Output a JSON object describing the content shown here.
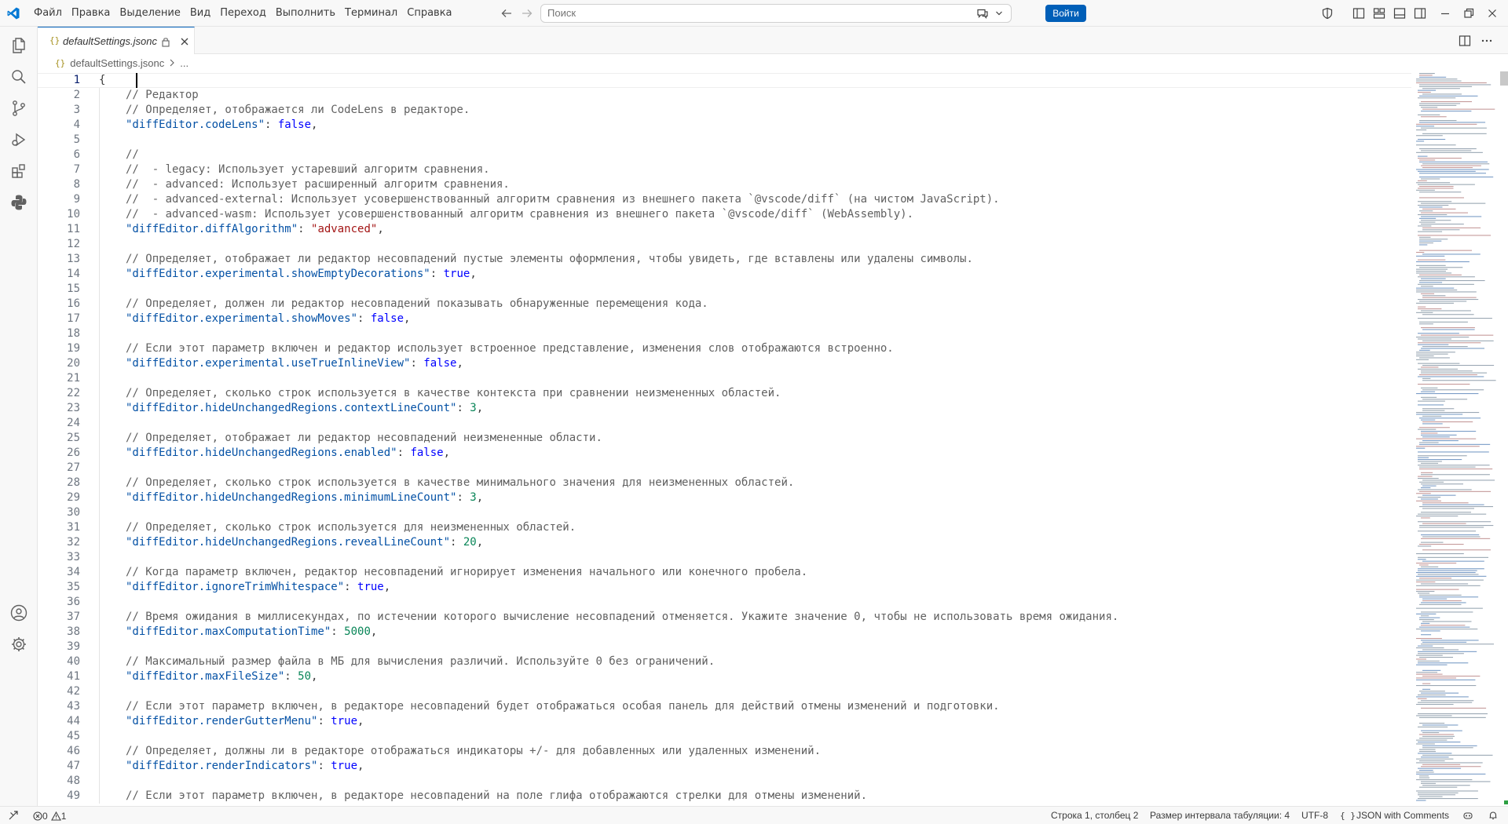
{
  "menu": [
    "Файл",
    "Правка",
    "Выделение",
    "Вид",
    "Переход",
    "Выполнить",
    "Терминал",
    "Справка"
  ],
  "search": {
    "placeholder": "Поиск"
  },
  "titlebar": {
    "signin_label": "Войти"
  },
  "tab": {
    "json_glyph": "{}",
    "title": "defaultSettings.jsonc"
  },
  "breadcrumb": {
    "file": "defaultSettings.jsonc",
    "rest": "..."
  },
  "editor": {
    "lines": [
      [
        [
          "p",
          "{"
        ]
      ],
      [
        [
          "c",
          "// Редактор"
        ]
      ],
      [
        [
          "c",
          "// Определяет, отображается ли CodeLens в редакторе."
        ]
      ],
      [
        [
          "k",
          "\"diffEditor.codeLens\""
        ],
        [
          "p",
          ": "
        ],
        [
          "b",
          "false"
        ],
        [
          "p",
          ","
        ]
      ],
      [],
      [
        [
          "c",
          "//"
        ]
      ],
      [
        [
          "c",
          "//  - legacy: Использует устаревший алгоритм сравнения."
        ]
      ],
      [
        [
          "c",
          "//  - advanced: Использует расширенный алгоритм сравнения."
        ]
      ],
      [
        [
          "c",
          "//  - advanced-external: Использует усовершенствованный алгоритм сравнения из внешнего пакета `@vscode/diff` (на чистом JavaScript)."
        ]
      ],
      [
        [
          "c",
          "//  - advanced-wasm: Использует усовершенствованный алгоритм сравнения из внешнего пакета `@vscode/diff` (WebAssembly)."
        ]
      ],
      [
        [
          "k",
          "\"diffEditor.diffAlgorithm\""
        ],
        [
          "p",
          ": "
        ],
        [
          "s",
          "\"advanced\""
        ],
        [
          "p",
          ","
        ]
      ],
      [],
      [
        [
          "c",
          "// Определяет, отображает ли редактор несовпадений пустые элементы оформления, чтобы увидеть, где вставлены или удалены символы."
        ]
      ],
      [
        [
          "k",
          "\"diffEditor.experimental.showEmptyDecorations\""
        ],
        [
          "p",
          ": "
        ],
        [
          "b",
          "true"
        ],
        [
          "p",
          ","
        ]
      ],
      [],
      [
        [
          "c",
          "// Определяет, должен ли редактор несовпадений показывать обнаруженные перемещения кода."
        ]
      ],
      [
        [
          "k",
          "\"diffEditor.experimental.showMoves\""
        ],
        [
          "p",
          ": "
        ],
        [
          "b",
          "false"
        ],
        [
          "p",
          ","
        ]
      ],
      [],
      [
        [
          "c",
          "// Если этот параметр включен и редактор использует встроенное представление, изменения слов отображаются встроенно."
        ]
      ],
      [
        [
          "k",
          "\"diffEditor.experimental.useTrueInlineView\""
        ],
        [
          "p",
          ": "
        ],
        [
          "b",
          "false"
        ],
        [
          "p",
          ","
        ]
      ],
      [],
      [
        [
          "c",
          "// Определяет, сколько строк используется в качестве контекста при сравнении неизмененных областей."
        ]
      ],
      [
        [
          "k",
          "\"diffEditor.hideUnchangedRegions.contextLineCount\""
        ],
        [
          "p",
          ": "
        ],
        [
          "n",
          "3"
        ],
        [
          "p",
          ","
        ]
      ],
      [],
      [
        [
          "c",
          "// Определяет, отображает ли редактор несовпадений неизмененные области."
        ]
      ],
      [
        [
          "k",
          "\"diffEditor.hideUnchangedRegions.enabled\""
        ],
        [
          "p",
          ": "
        ],
        [
          "b",
          "false"
        ],
        [
          "p",
          ","
        ]
      ],
      [],
      [
        [
          "c",
          "// Определяет, сколько строк используется в качестве минимального значения для неизмененных областей."
        ]
      ],
      [
        [
          "k",
          "\"diffEditor.hideUnchangedRegions.minimumLineCount\""
        ],
        [
          "p",
          ": "
        ],
        [
          "n",
          "3"
        ],
        [
          "p",
          ","
        ]
      ],
      [],
      [
        [
          "c",
          "// Определяет, сколько строк используется для неизмененных областей."
        ]
      ],
      [
        [
          "k",
          "\"diffEditor.hideUnchangedRegions.revealLineCount\""
        ],
        [
          "p",
          ": "
        ],
        [
          "n",
          "20"
        ],
        [
          "p",
          ","
        ]
      ],
      [],
      [
        [
          "c",
          "// Когда параметр включен, редактор несовпадений игнорирует изменения начального или конечного пробела."
        ]
      ],
      [
        [
          "k",
          "\"diffEditor.ignoreTrimWhitespace\""
        ],
        [
          "p",
          ": "
        ],
        [
          "b",
          "true"
        ],
        [
          "p",
          ","
        ]
      ],
      [],
      [
        [
          "c",
          "// Время ожидания в миллисекундах, по истечении которого вычисление несовпадений отменяется. Укажите значение 0, чтобы не использовать время ожидания."
        ]
      ],
      [
        [
          "k",
          "\"diffEditor.maxComputationTime\""
        ],
        [
          "p",
          ": "
        ],
        [
          "n",
          "5000"
        ],
        [
          "p",
          ","
        ]
      ],
      [],
      [
        [
          "c",
          "// Максимальный размер файла в МБ для вычисления различий. Используйте 0 без ограничений."
        ]
      ],
      [
        [
          "k",
          "\"diffEditor.maxFileSize\""
        ],
        [
          "p",
          ": "
        ],
        [
          "n",
          "50"
        ],
        [
          "p",
          ","
        ]
      ],
      [],
      [
        [
          "c",
          "// Если этот параметр включен, в редакторе несовпадений будет отображаться особая панель для действий отмены изменений и подготовки."
        ]
      ],
      [
        [
          "k",
          "\"diffEditor.renderGutterMenu\""
        ],
        [
          "p",
          ": "
        ],
        [
          "b",
          "true"
        ],
        [
          "p",
          ","
        ]
      ],
      [],
      [
        [
          "c",
          "// Определяет, должны ли в редакторе отображаться индикаторы +/- для добавленных или удаленных изменений."
        ]
      ],
      [
        [
          "k",
          "\"diffEditor.renderIndicators\""
        ],
        [
          "p",
          ": "
        ],
        [
          "b",
          "true"
        ],
        [
          "p",
          ","
        ]
      ],
      [],
      [
        [
          "c",
          "// Если этот параметр включен, в редакторе несовпадений на поле глифа отображаются стрелки для отмены изменений."
        ]
      ]
    ]
  },
  "status": {
    "errors": "0",
    "warnings": "1",
    "position": "Строка 1, столбец 2",
    "tab_size": "Размер интервала табуляции: 4",
    "encoding": "UTF-8",
    "language_glyph": "{ }",
    "language": "JSON with Comments"
  },
  "colors": {
    "accent": "#005fb8",
    "comment": "#616161",
    "key": "#0451a5",
    "string": "#a31515",
    "number": "#098658",
    "keyword": "#0000ff"
  }
}
